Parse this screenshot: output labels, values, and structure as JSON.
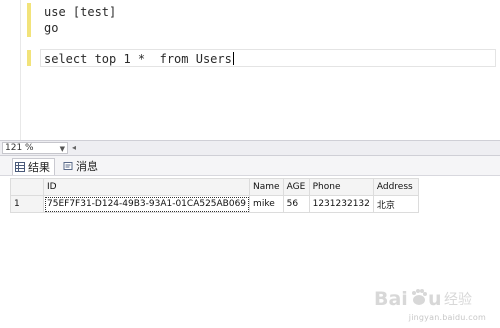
{
  "editor": {
    "lines": [
      "use [test]",
      "go",
      "select top 1 *  from Users"
    ]
  },
  "zoom": {
    "value": "121 %"
  },
  "tabs": {
    "results_label": "结果",
    "messages_label": "消息"
  },
  "grid": {
    "columns": [
      "ID",
      "Name",
      "AGE",
      "Phone",
      "Address"
    ],
    "rows": [
      {
        "row_number": "1",
        "cells": [
          "75EF7F31-D124-49B3-93A1-01CA525AB069",
          "mike",
          "56",
          "1231232132",
          "北京"
        ]
      }
    ]
  },
  "watermark": {
    "text": "Baidu 经验",
    "subtext": "jingyan.baidu.com"
  },
  "colors": {
    "change_bar": "#f2e37a",
    "keyword": "#2a2a2a",
    "grid_border": "#dcdcdc"
  }
}
